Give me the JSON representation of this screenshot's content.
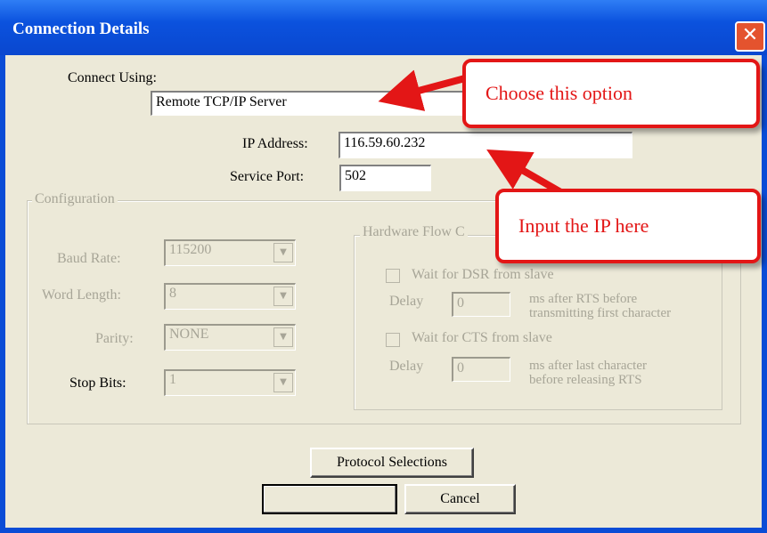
{
  "window": {
    "title": "Connection Details",
    "close_glyph": "✕"
  },
  "connect_using": {
    "label": "Connect Using:",
    "value": "Remote TCP/IP Server"
  },
  "ip": {
    "label": "IP Address:",
    "value": "116.59.60.232"
  },
  "port": {
    "label": "Service Port:",
    "value": "502"
  },
  "configuration": {
    "legend": "Configuration",
    "baud_rate": {
      "label": "Baud Rate:",
      "value": "115200"
    },
    "word_length": {
      "label": "Word Length:",
      "value": "8"
    },
    "parity": {
      "label": "Parity:",
      "value": "NONE"
    },
    "stop_bits": {
      "label": "Stop Bits:",
      "value": "1"
    }
  },
  "hardware_flow": {
    "legend": "Hardware Flow C",
    "dsr": {
      "label": "Wait for DSR from slave",
      "delay_label": "Delay",
      "delay_value": "0",
      "note_line1": "ms after RTS before",
      "note_line2": "transmitting first character"
    },
    "cts": {
      "label": "Wait for CTS from slave",
      "delay_label": "Delay",
      "delay_value": "0",
      "note_line1": "ms after last character",
      "note_line2": "before releasing RTS"
    }
  },
  "buttons": {
    "protocol": "Protocol Selections",
    "ok": "",
    "cancel": "Cancel"
  },
  "annotations": {
    "callout1": "Choose this option",
    "callout2": "Input the IP here",
    "color": "#e31616"
  }
}
